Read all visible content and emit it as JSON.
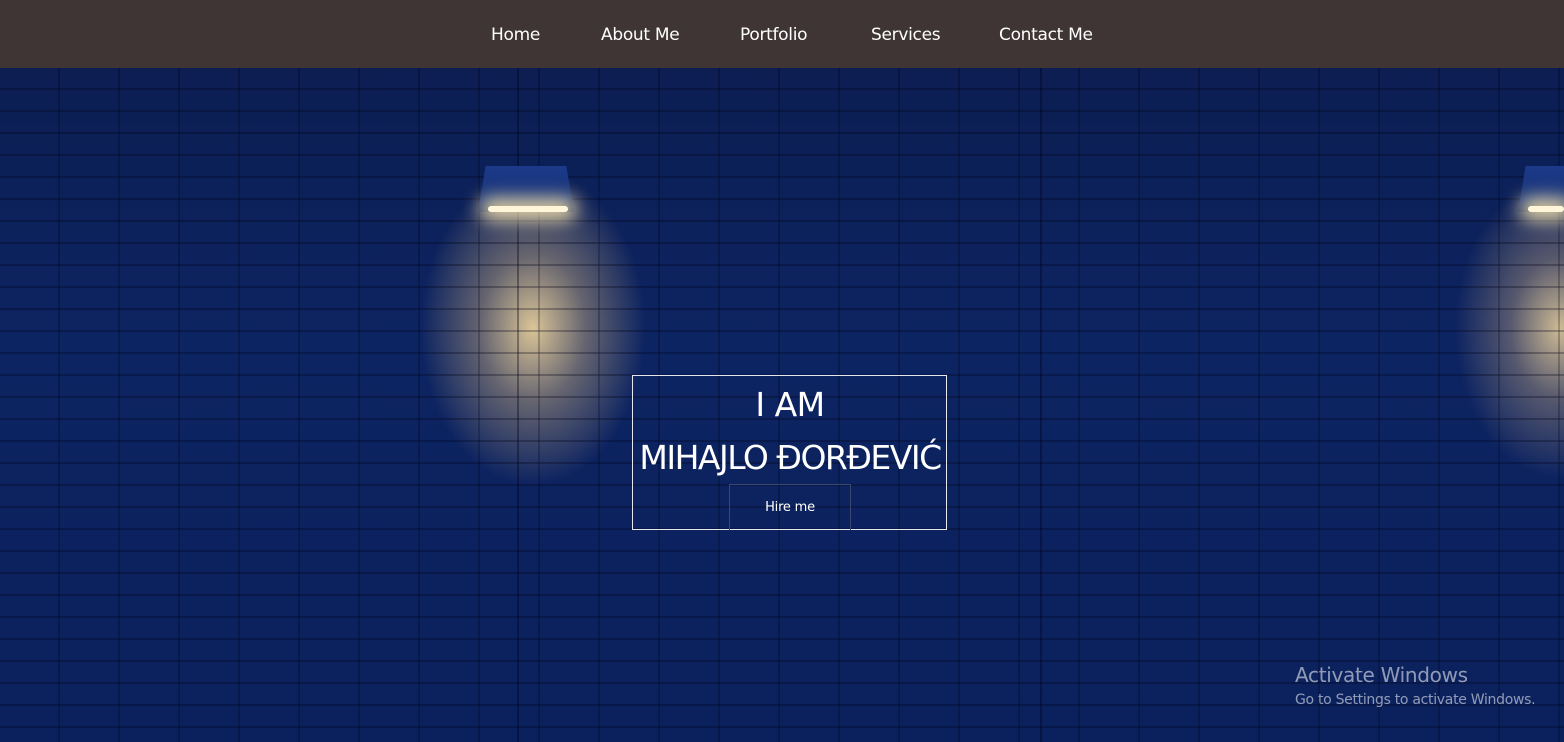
{
  "nav": {
    "items": [
      {
        "label": "Home"
      },
      {
        "label": "About Me"
      },
      {
        "label": "Portfolio"
      },
      {
        "label": "Services"
      },
      {
        "label": "Contact Me"
      }
    ]
  },
  "hero": {
    "line1": "I AM",
    "line2": "MIHAJLO ĐORĐEVIĆ",
    "hire_button_label": "Hire me"
  },
  "windows_watermark": {
    "title": "Activate Windows",
    "subtitle": "Go to Settings to activate Windows."
  },
  "colors": {
    "navbar_bg": "#3e3534",
    "hero_bg": "#0d2462",
    "text": "#ffffff"
  }
}
